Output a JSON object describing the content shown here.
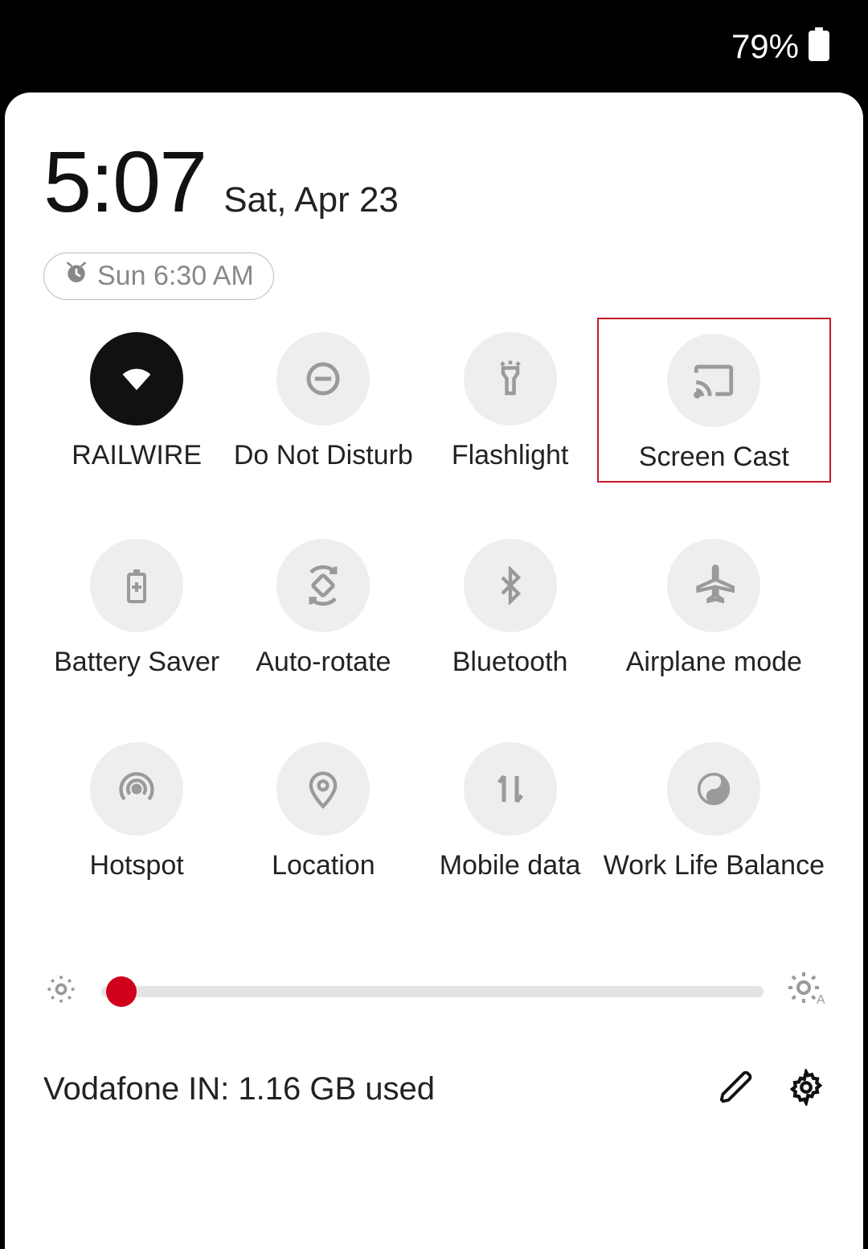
{
  "status": {
    "battery_pct": "79%"
  },
  "header": {
    "time": "5:07",
    "date": "Sat, Apr 23",
    "alarm": "Sun 6:30 AM"
  },
  "tiles": [
    {
      "id": "wifi",
      "label": "RAILWIRE",
      "icon": "wifi",
      "active": true
    },
    {
      "id": "dnd",
      "label": "Do Not Disturb",
      "icon": "dnd",
      "active": false
    },
    {
      "id": "flashlight",
      "label": "Flashlight",
      "icon": "flashlight",
      "active": false
    },
    {
      "id": "screencast",
      "label": "Screen Cast",
      "icon": "cast",
      "active": false,
      "highlight": true
    },
    {
      "id": "batterysaver",
      "label": "Battery Saver",
      "icon": "battery",
      "active": false
    },
    {
      "id": "autorotate",
      "label": "Auto-rotate",
      "icon": "rotate",
      "active": false
    },
    {
      "id": "bluetooth",
      "label": "Bluetooth",
      "icon": "bluetooth",
      "active": false
    },
    {
      "id": "airplane",
      "label": "Airplane mode",
      "icon": "airplane",
      "active": false
    },
    {
      "id": "hotspot",
      "label": "Hotspot",
      "icon": "hotspot",
      "active": false
    },
    {
      "id": "location",
      "label": "Location",
      "icon": "location",
      "active": false
    },
    {
      "id": "mobiledata",
      "label": "Mobile data",
      "icon": "data",
      "active": false
    },
    {
      "id": "worklife",
      "label": "Work Life Balance",
      "icon": "balance",
      "active": false
    }
  ],
  "brightness": {
    "value_pct": 3
  },
  "footer": {
    "data_usage": "Vodafone IN: 1.16 GB used"
  }
}
